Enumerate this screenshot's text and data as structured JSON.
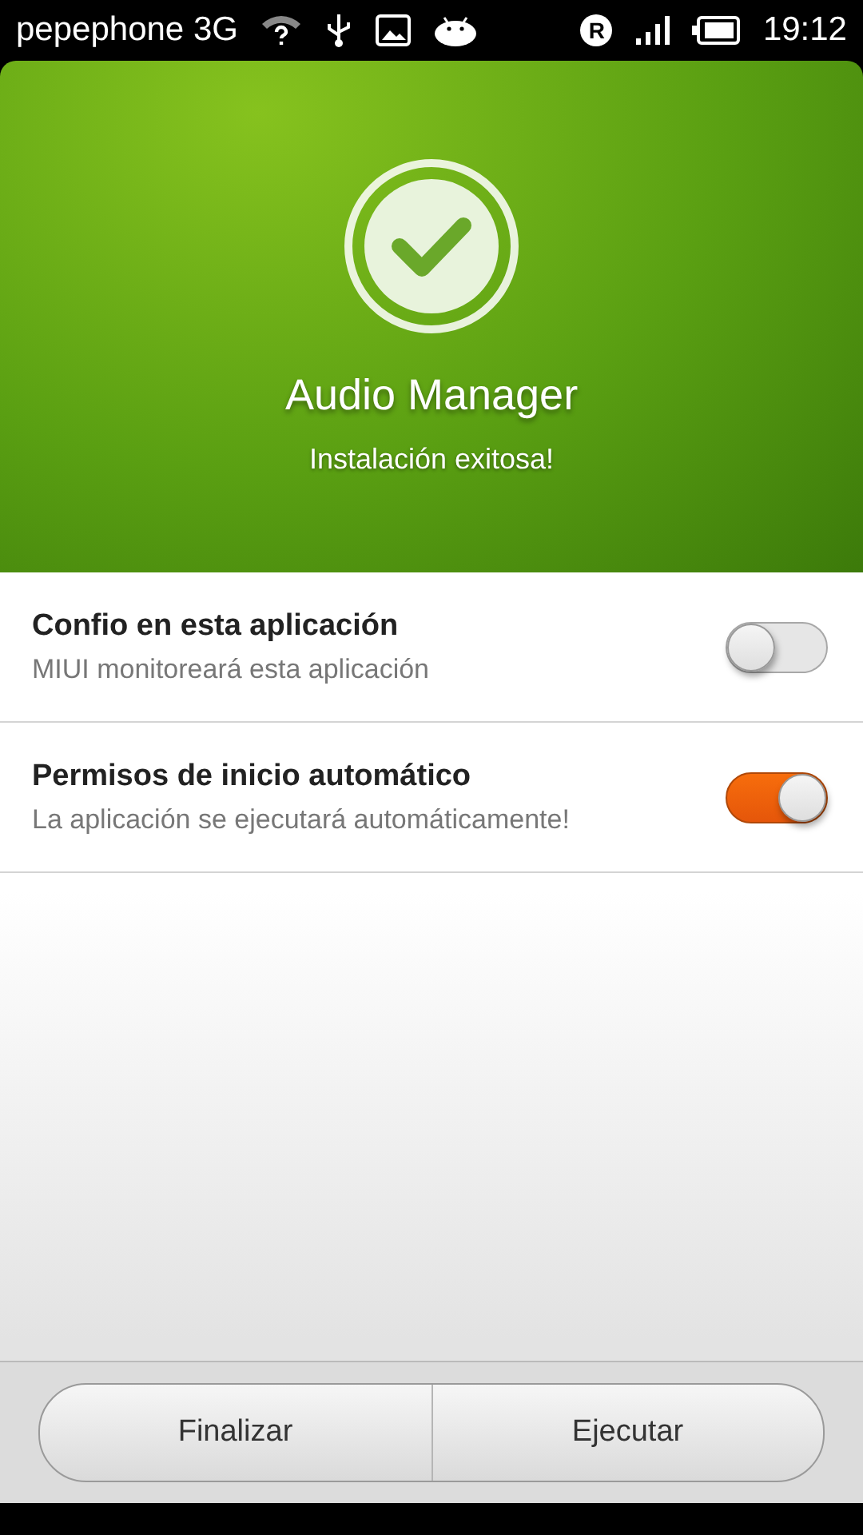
{
  "status_bar": {
    "carrier": "pepephone 3G",
    "roaming": "R",
    "time": "19:12"
  },
  "header": {
    "app_name": "Audio Manager",
    "message": "Instalación exitosa!"
  },
  "settings": [
    {
      "title": "Confio en esta aplicación",
      "subtitle": "MIUI monitoreará esta aplicación",
      "on": false
    },
    {
      "title": "Permisos de inicio automático",
      "subtitle": "La aplicación se ejecutará automáticamente!",
      "on": true
    }
  ],
  "buttons": [
    "Finalizar",
    "Ejecutar"
  ]
}
